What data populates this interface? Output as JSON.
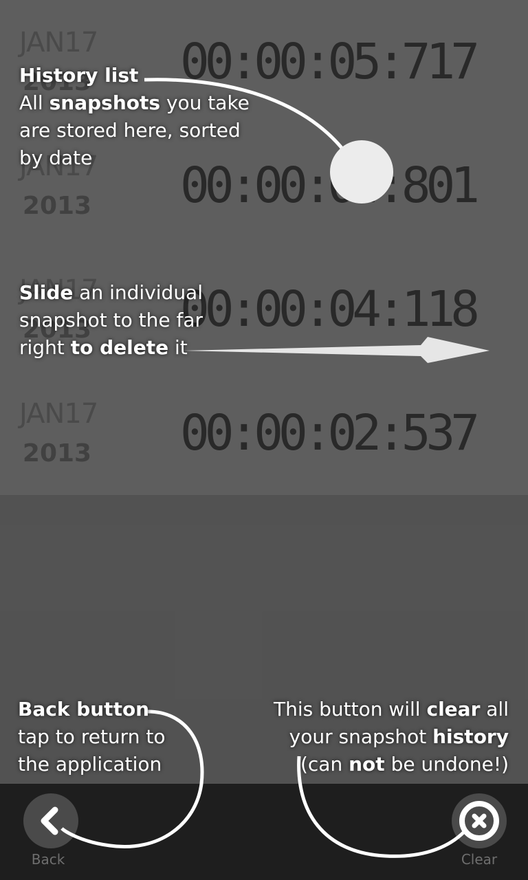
{
  "history": [
    {
      "month": "JAN17",
      "year": "2013",
      "time": "00:00:05:717"
    },
    {
      "month": "JAN17",
      "year": "2013",
      "time": "00:00:04:801"
    },
    {
      "month": "JAN17",
      "year": "2013",
      "time": "00:00:04:118"
    },
    {
      "month": "JAN17",
      "year": "2013",
      "time": "00:00:02:537"
    }
  ],
  "bottom_bar": {
    "back_label": "Back",
    "clear_label": "Clear"
  },
  "tutorial": {
    "history": {
      "title": "History list",
      "l1_pre": "All ",
      "l1_bold": "snapshots",
      "l1_post": " you take",
      "l2": "are stored here, sorted",
      "l3": "by date"
    },
    "slide": {
      "bold1": "Slide",
      "post1": " an individual",
      "l2": "snapshot to the far",
      "pre3": "right ",
      "bold3": "to delete",
      "post3": " it"
    },
    "back": {
      "title": "Back button",
      "l2": "tap to return to",
      "l3": "the application"
    },
    "clear": {
      "pre1": "This button will ",
      "bold1": "clear",
      "post1": " all",
      "pre2": "your snapshot ",
      "bold2": "history",
      "pre3": "(can ",
      "bold3": "not",
      "post3": " be undone!)"
    }
  }
}
